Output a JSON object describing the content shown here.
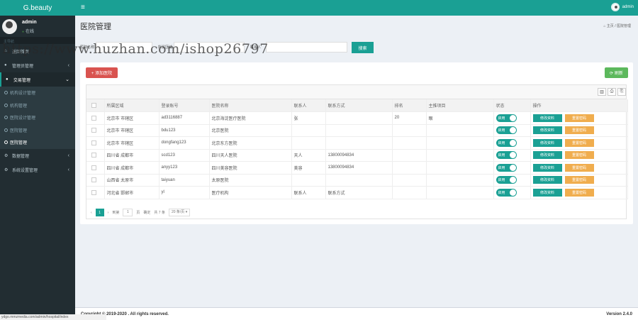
{
  "app": {
    "logo": "G.beauty",
    "menu_icon": "≡",
    "user_name": "admin"
  },
  "sidebar": {
    "user": "admin",
    "status": "在线",
    "nav_header": "主导航",
    "items": [
      {
        "label": "返回首页",
        "icon": "home-icon"
      },
      {
        "label": "管理员管理",
        "icon": "user-icon"
      },
      {
        "label": "交易管理",
        "icon": "user-icon"
      }
    ],
    "sub_items": [
      "机构设计管理",
      "机构管理",
      "医院设计管理",
      "医院管理",
      "医院管理"
    ],
    "items_after": [
      {
        "label": "数据管理",
        "icon": "gear-icon"
      },
      {
        "label": "系统设置管理",
        "icon": "gear-icon"
      }
    ]
  },
  "page": {
    "title": "医院管理",
    "crumb_home": "主页",
    "crumb_current": "医院管理"
  },
  "watermark": "https://www.huzhan.com/ishop26797",
  "search": {
    "btn": "搜索",
    "labels": [
      "医院名称",
      "所属区域",
      "联系人"
    ]
  },
  "toolbar": {
    "add": "+ 添加医院",
    "refresh": "⟳ 刷新"
  },
  "table": {
    "headers": [
      "所属区域",
      "登录账号",
      "医院名称",
      "联系人",
      "联系方式",
      "排名",
      "主推项目",
      "状态",
      "操作"
    ],
    "rows": [
      [
        "北京市 市辖区",
        "ad3116887",
        "北京海淀医疗医院",
        "张",
        "",
        "20",
        "眼",
        "启用"
      ],
      [
        "北京市 市辖区",
        "bdu123",
        "北京医院",
        "",
        "",
        "",
        "",
        "启用"
      ],
      [
        "北京市 市辖区",
        "dongfang123",
        "北京东方医院",
        "",
        "",
        "",
        "",
        "启用"
      ],
      [
        "四川省 成都市",
        "scd123",
        "四川天人医院",
        "天人",
        "13800094834",
        "",
        "",
        "启用"
      ],
      [
        "四川省 成都市",
        "anyy123",
        "四川美容医院",
        "美容",
        "13800094834",
        "",
        "",
        "启用"
      ],
      [
        "山西省 太原市",
        "taiyuan",
        "太原医院",
        "",
        "",
        "",
        "",
        "启用"
      ],
      [
        "河北省 邯郸市",
        "yl",
        "医疗机构",
        "联系人",
        "联系方式",
        "",
        "",
        "启用"
      ]
    ],
    "op_edit": "修改资料",
    "op_reset": "重置密码"
  },
  "pager": {
    "prev": "‹",
    "current": "1",
    "next": "›",
    "goto": "到第",
    "goto_value": "1",
    "page_unit": "页",
    "confirm": "确定",
    "total": "共 7 条",
    "size": "20 条/页"
  },
  "footer": {
    "copyright": "Copyright © 2019-2020 . All rights reserved.",
    "version": "Version 2.4.0"
  },
  "statusbar": "ydgo.mmzmedia.com/admin/hospital/index"
}
